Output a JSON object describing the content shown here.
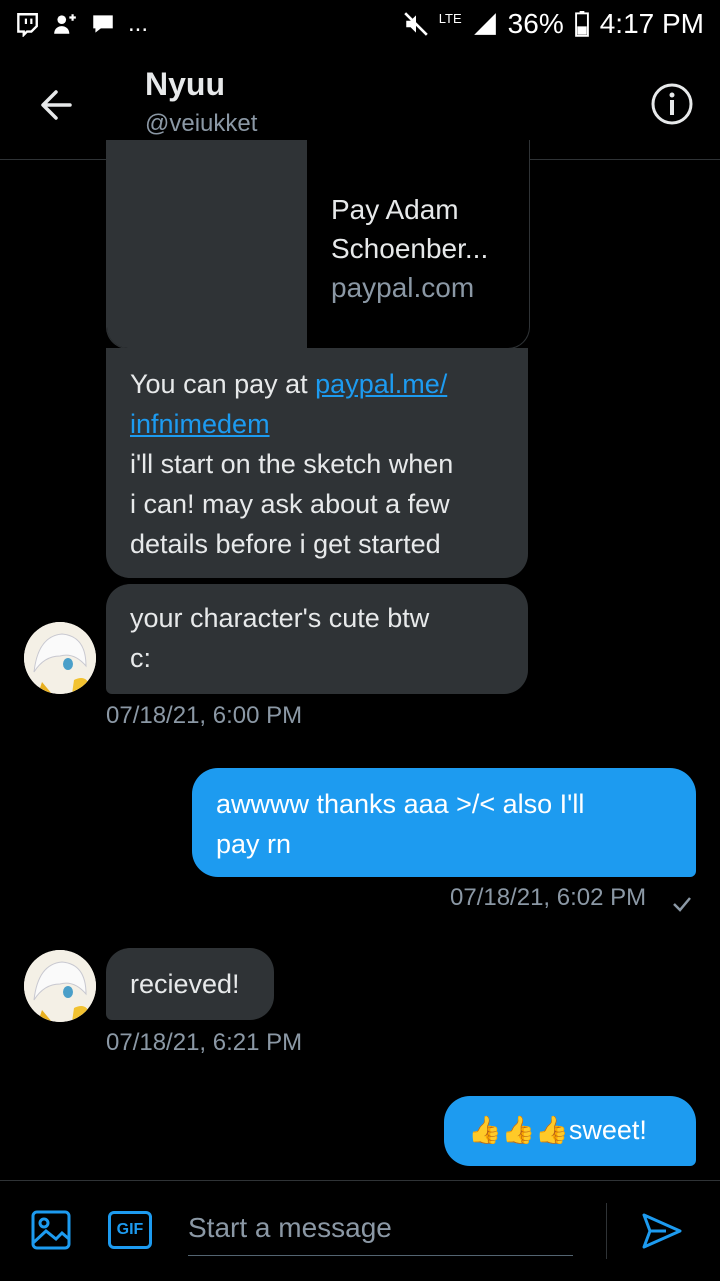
{
  "status": {
    "network": "LTE",
    "battery": "36%",
    "time": "4:17 PM",
    "overflow": "..."
  },
  "header": {
    "name": "Nyuu",
    "handle": "@veiukket"
  },
  "card": {
    "title_line1": "Pay Adam",
    "title_line2": "Schoenber...",
    "domain": "paypal.com"
  },
  "messages": {
    "m1": {
      "text": "You can pay at ",
      "link_line1": "paypal.me/",
      "link_line2": "infnimedem",
      "line3": "i'll start on the sketch when",
      "line4": "i can! may ask about a few",
      "line5": "details before i get started"
    },
    "m2": {
      "line1": "your character's cute btw",
      "line2": "c:"
    },
    "ts1": "07/18/21, 6:00 PM",
    "m3": {
      "line1": "awwww thanks aaa >/< also I'll",
      "line2": "pay rn"
    },
    "ts2": "07/18/21, 6:02 PM",
    "m4": "recieved!",
    "ts3": "07/18/21, 6:21 PM",
    "m5": {
      "emoji": "👍👍👍",
      "text": "sweet!"
    }
  },
  "composer": {
    "placeholder": "Start a message",
    "gif_label": "GIF"
  },
  "colors": {
    "accent": "#1d9bf0",
    "bubble_in": "#2f3336",
    "muted": "#8b98a5"
  }
}
